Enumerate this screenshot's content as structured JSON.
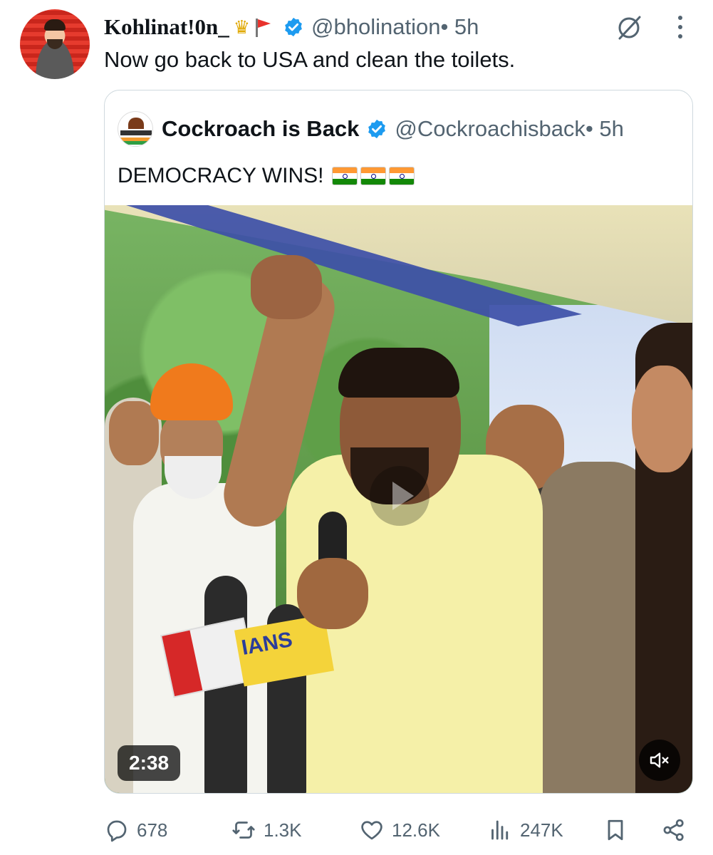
{
  "tweet": {
    "display_name": "Kohlinat!0n_",
    "name_emojis": [
      "crown-emoji",
      "flag-emoji"
    ],
    "handle": "@bholination",
    "time": " • 5h",
    "text": "Now go back to USA and clean the toilets."
  },
  "quote": {
    "display_name": "Cockroach is Back",
    "handle": "@Cockroachisback",
    "time": " • 5h",
    "text": "DEMOCRACY WINS!",
    "flags": [
      "india-flag",
      "india-flag",
      "india-flag"
    ],
    "media": {
      "duration": "2:38",
      "mic_label": "IANS",
      "mute_icon": "speaker-muted-icon"
    }
  },
  "actions": {
    "replies": "678",
    "reposts": "1.3K",
    "likes": "12.6K",
    "views": "247K"
  },
  "colors": {
    "verified": "#1d9bf0",
    "secondary_text": "#536471",
    "border": "#cfd9de"
  }
}
